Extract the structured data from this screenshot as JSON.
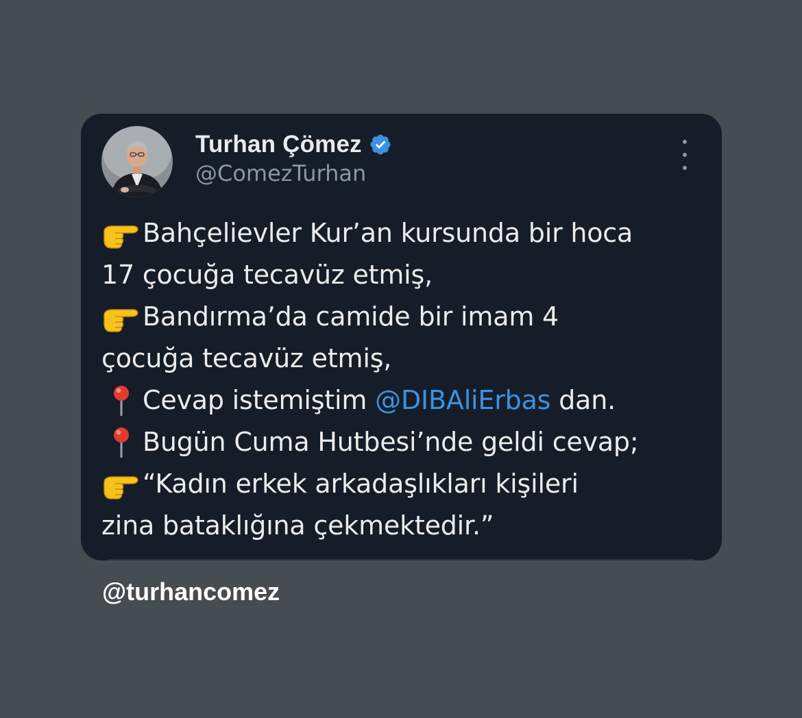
{
  "tweet": {
    "author": {
      "display_name": "Turhan Çömez",
      "handle": "@ComezTurhan",
      "verified": true,
      "avatar": "profile-photo"
    },
    "more_icon": "more-vertical-icon",
    "lines": [
      {
        "emoji": "pointing-right-hand-emoji",
        "text": "Bahçelievler Kur’an kursunda bir hoca"
      },
      {
        "emoji": "",
        "text": "17 çocuğa tecavüz etmiş,"
      },
      {
        "emoji": "pointing-right-hand-emoji",
        "text": "Bandırma’da camide bir imam 4"
      },
      {
        "emoji": "",
        "text": "çocuğa tecavüz etmiş,"
      },
      {
        "emoji": "round-pushpin-emoji",
        "text_before": "Cevap istemiştim",
        "mention": "@DIBAliErbas",
        "text_after": "dan."
      },
      {
        "emoji": "round-pushpin-emoji",
        "text": "Bugün Cuma Hutbesi’nde geldi cevap;"
      },
      {
        "emoji": "pointing-right-hand-emoji",
        "text": "“Kadın erkek arkadaşlıkları kişileri"
      },
      {
        "emoji": "",
        "text": "zina bataklığına çekmektedir.”"
      }
    ]
  },
  "watermark": "@turhancomez",
  "colors": {
    "page_background": "#454c52",
    "card_background": "#151d29",
    "primary_text": "#ececec",
    "secondary_text": "#8b97a3",
    "mention_link": "#3d92e0",
    "verified_badge": "#3d92e0"
  }
}
